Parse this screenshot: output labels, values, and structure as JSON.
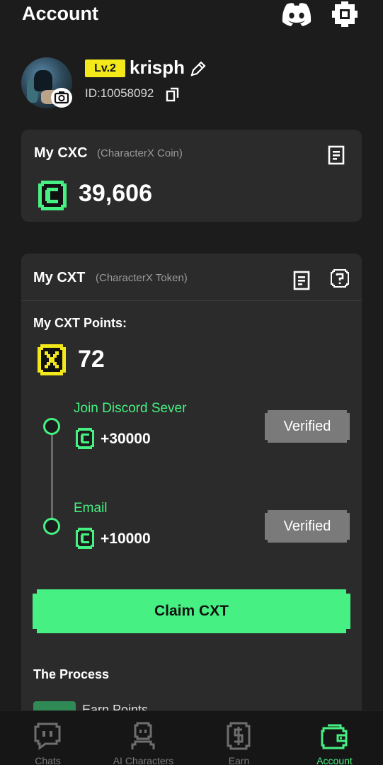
{
  "header": {
    "title": "Account",
    "icons": [
      "discord-icon",
      "gear-icon"
    ]
  },
  "profile": {
    "level": "Lv.2",
    "username": "krisph",
    "user_id": "ID:10058092",
    "icons": [
      "camera-icon",
      "pencil-icon",
      "copy-icon"
    ]
  },
  "cxc": {
    "title": "My CXC",
    "subtitle": "(CharacterX Coin)",
    "amount": "39,606",
    "icons": [
      "record-icon",
      "coin-icon"
    ]
  },
  "cxt": {
    "title": "My CXT",
    "subtitle": "(CharacterX Token)",
    "points_label": "My CXT Points:",
    "points_value": "72",
    "icons": [
      "record-icon",
      "help-icon",
      "x-token-icon"
    ],
    "tasks": [
      {
        "title": "Join Discord Sever",
        "reward": "+30000",
        "status": "Verified"
      },
      {
        "title": "Email",
        "reward": "+10000",
        "status": "Verified"
      }
    ],
    "claim_label": "Claim CXT",
    "process_title": "The Process",
    "process_peek": "Earn Points"
  },
  "nav": {
    "tabs": [
      {
        "label": "Chats",
        "icon": "chat-icon",
        "active": false
      },
      {
        "label": "AI Characters",
        "icon": "character-icon",
        "active": false
      },
      {
        "label": "Earn",
        "icon": "dollar-icon",
        "active": false
      },
      {
        "label": "Account",
        "icon": "wallet-icon",
        "active": true
      }
    ]
  },
  "colors": {
    "background": "#1c1c1c",
    "card": "#2b2b2b",
    "accent_green": "#46f082",
    "level_yellow": "#f2e81a",
    "button_gray": "#7a7a7a"
  }
}
